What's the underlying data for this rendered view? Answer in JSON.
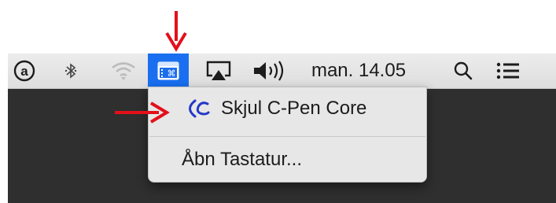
{
  "menubar": {
    "clock": "man. 14.05",
    "icons": [
      "accessibility-at-icon",
      "bluetooth-icon",
      "wifi-icon",
      "keyboard-viewer-icon",
      "airplay-icon",
      "volume-icon",
      "spotlight-search-icon",
      "notification-center-icon"
    ]
  },
  "dropdown": {
    "items": [
      {
        "label": "Skjul C-Pen Core",
        "icon": "c-pen-logo-icon"
      },
      {
        "label": "Åbn Tastatur..."
      }
    ]
  },
  "colors": {
    "highlight": "#1a6ff0",
    "arrow": "#e3101a",
    "menu_bg": "#e7e7e7",
    "desktop": "#2f2f2f",
    "cpen_logo": "#2438c8"
  }
}
